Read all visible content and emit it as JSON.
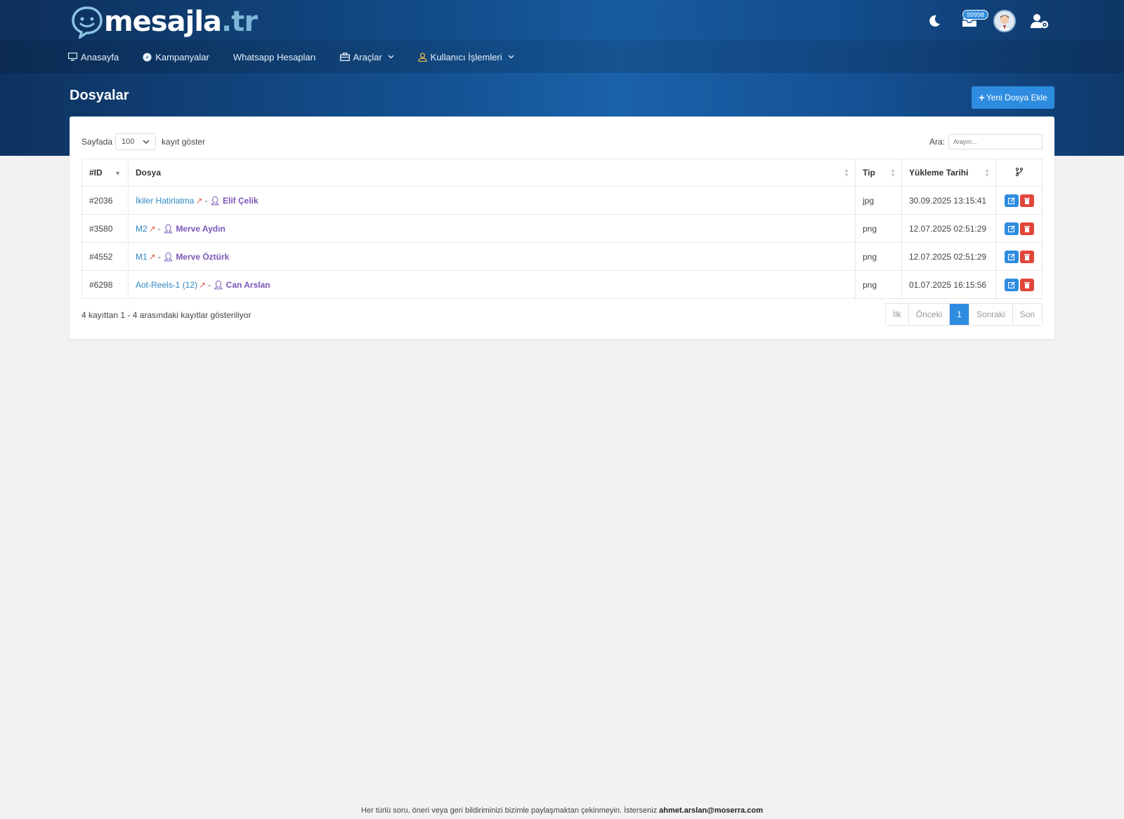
{
  "brand": {
    "name": "mesajla",
    "tld": ".tr"
  },
  "topbar": {
    "badge_count": "99998"
  },
  "nav": [
    {
      "label": "Anasayfa",
      "icon": "monitor-icon"
    },
    {
      "label": "Kampanyalar",
      "icon": "compass-icon"
    },
    {
      "label": "Whatsapp Hesapları",
      "icon": ""
    },
    {
      "label": "Araçlar",
      "icon": "briefcase-icon",
      "dropdown": true
    },
    {
      "label": "Kullanıcı İşlemleri",
      "icon": "user-icon",
      "dropdown": true
    }
  ],
  "page": {
    "title": "Dosyalar",
    "add_button": "Yeni Dosya Ekle"
  },
  "table_controls": {
    "length_prefix": "Sayfada",
    "length_value": "100",
    "length_suffix": "kayıt göster",
    "search_label": "Ara:",
    "search_placeholder": "Arayın..."
  },
  "table": {
    "headers": {
      "id": "#ID",
      "file": "Dosya",
      "type": "Tip",
      "date": "Yükleme Tarihi"
    },
    "rows": [
      {
        "id": "#2036",
        "file": "İkiler Hatirlatma",
        "user": "Elif Çelik",
        "type": "jpg",
        "date": "30.09.2025 13:15:41"
      },
      {
        "id": "#3580",
        "file": "M2",
        "user": "Merve Aydın",
        "type": "png",
        "date": "12.07.2025 02:51:29"
      },
      {
        "id": "#4552",
        "file": "M1",
        "user": "Merve Öztürk",
        "type": "png",
        "date": "12.07.2025 02:51:29"
      },
      {
        "id": "#6298",
        "file": "Aot-Reels-1 (12)",
        "user": "Can Arslan",
        "type": "png",
        "date": "01.07.2025 16:15:56"
      }
    ]
  },
  "info_text": "4 kayıttan 1 - 4 arasındaki kayıtlar gösteriliyor",
  "pagination": {
    "first": "İlk",
    "prev": "Önceki",
    "current": "1",
    "next": "Sonraki",
    "last": "Son"
  },
  "footer": {
    "text": "Her türlü soru, öneri veya geri bildiriminizi bizimle paylaşmaktan çekinmeyin. İsterseniz",
    "email": "ahmet.arslan@moserra.com"
  },
  "colors": {
    "primary": "#2e8ce0",
    "danger": "#e0463a",
    "link": "#2e86c1",
    "user": "#7a56b8",
    "header_bg": "#145394"
  }
}
